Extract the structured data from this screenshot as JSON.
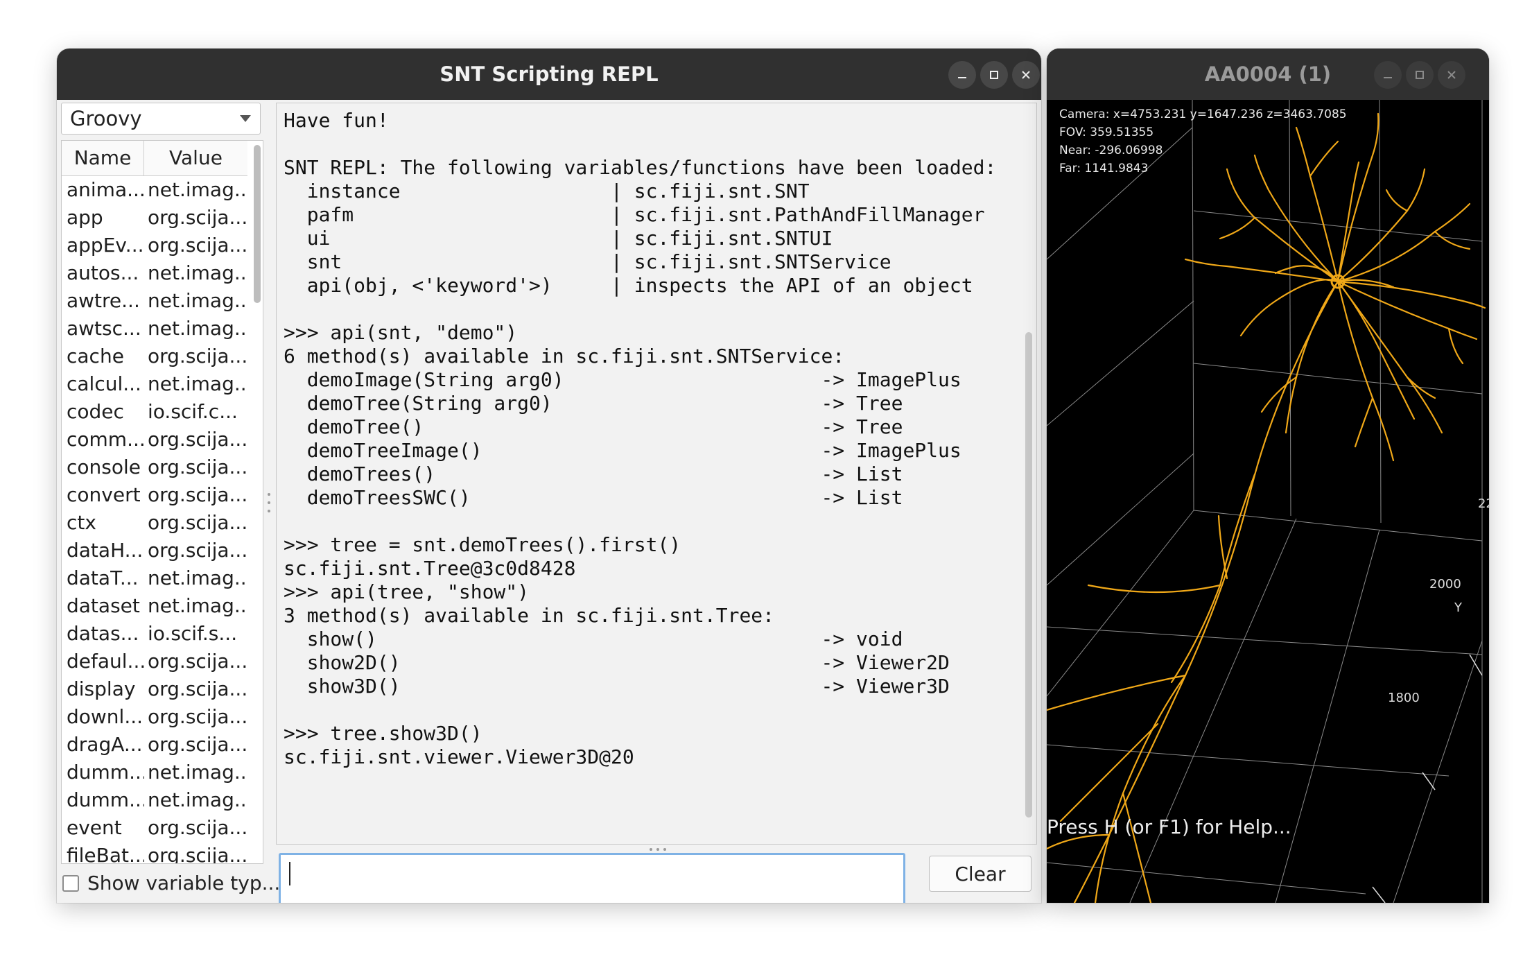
{
  "repl": {
    "title": "SNT Scripting REPL",
    "language": "Groovy",
    "columns": {
      "name": "Name",
      "value": "Value"
    },
    "variables": [
      {
        "name": "anima...",
        "value": "net.imag..."
      },
      {
        "name": "app",
        "value": "org.scija..."
      },
      {
        "name": "appEv...",
        "value": "org.scija..."
      },
      {
        "name": "autos...",
        "value": "net.imag..."
      },
      {
        "name": "awtre...",
        "value": "net.imag..."
      },
      {
        "name": "awtsc...",
        "value": "net.imag..."
      },
      {
        "name": "cache",
        "value": "org.scija..."
      },
      {
        "name": "calcul...",
        "value": "net.imag..."
      },
      {
        "name": "codec",
        "value": "io.scif.c..."
      },
      {
        "name": "comm...",
        "value": "org.scija..."
      },
      {
        "name": "console",
        "value": "org.scija..."
      },
      {
        "name": "convert",
        "value": "org.scija..."
      },
      {
        "name": "ctx",
        "value": "org.scija..."
      },
      {
        "name": "dataH...",
        "value": "org.scija..."
      },
      {
        "name": "dataT...",
        "value": "net.imag..."
      },
      {
        "name": "dataset",
        "value": "net.imag..."
      },
      {
        "name": "datas...",
        "value": "io.scif.s..."
      },
      {
        "name": "defaul...",
        "value": "org.scija..."
      },
      {
        "name": "display",
        "value": "org.scija..."
      },
      {
        "name": "downl...",
        "value": "org.scija..."
      },
      {
        "name": "dragA...",
        "value": "org.scija..."
      },
      {
        "name": "dumm...",
        "value": "net.imag..."
      },
      {
        "name": "dumm...",
        "value": "net.imag..."
      },
      {
        "name": "event",
        "value": "org.scija..."
      },
      {
        "name": "fileBat...",
        "value": "org.scija..."
      }
    ],
    "show_types_label": "Show variable typ...",
    "output_lines": [
      "Have fun!",
      "",
      "SNT REPL: The following variables/functions have been loaded:",
      "  instance                  | sc.fiji.snt.SNT",
      "  pafm                      | sc.fiji.snt.PathAndFillManager",
      "  ui                        | sc.fiji.snt.SNTUI",
      "  snt                       | sc.fiji.snt.SNTService",
      "  api(obj, <'keyword'>)     | inspects the API of an object",
      "",
      ">>> api(snt, \"demo\")",
      "6 method(s) available in sc.fiji.snt.SNTService:",
      "  demoImage(String arg0)                      -> ImagePlus",
      "  demoTree(String arg0)                       -> Tree",
      "  demoTree()                                  -> Tree",
      "  demoTreeImage()                             -> ImagePlus",
      "  demoTrees()                                 -> List",
      "  demoTreesSWC()                              -> List",
      "",
      ">>> tree = snt.demoTrees().first()",
      "sc.fiji.snt.Tree@3c0d8428",
      ">>> api(tree, \"show\")",
      "3 method(s) available in sc.fiji.snt.Tree:",
      "  show()                                      -> void",
      "  show2D()                                    -> Viewer2D",
      "  show3D()                                    -> Viewer3D",
      "",
      ">>> tree.show3D()",
      "sc.fiji.snt.viewer.Viewer3D@20"
    ],
    "input_value": "",
    "clear_label": "Clear"
  },
  "viewer": {
    "title": "AA0004 (1)",
    "hud": [
      "Camera: x=4753.231 y=1647.236 z=3463.7085",
      "FOV: 359.51355",
      "Near: -296.06998",
      "Far: 1141.9843"
    ],
    "help_text": "Press H (or F1) for Help...",
    "axis_labels": {
      "tick_2200_partial": "22",
      "tick_2000": "2000",
      "axis_y": "Y",
      "tick_1800": "1800"
    },
    "neuron_color": "#f0a818"
  },
  "icons": {
    "minimize": "minimize-icon",
    "maximize": "maximize-icon",
    "close": "close-icon",
    "dropdown": "chevron-down-icon"
  }
}
